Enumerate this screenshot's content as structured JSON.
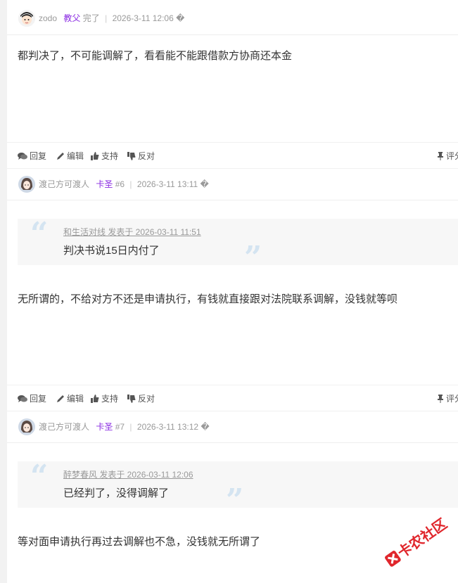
{
  "posts": [
    {
      "author": "zodo",
      "group": "教父",
      "status": "完了",
      "datetime": "2026-3-11 12:06 �",
      "content": "都判决了，不可能调解了，看看能不能跟借款方协商还本金"
    },
    {
      "author": "渡己方可渡人",
      "group": "卡圣",
      "floor": "#6",
      "datetime": "2026-3-11 13:11 �",
      "quote_author": "和生活对线 发表于 2026-03-11 11:51",
      "quote_text": "判决书说15日内付了",
      "content": "无所谓的，不给对方不还是申请执行，有钱就直接跟对法院联系调解，没钱就等呗"
    },
    {
      "author": "渡己方可渡人",
      "group": "卡圣",
      "floor": "#7",
      "datetime": "2026-3-11 13:12 �",
      "quote_author": "醉梦春风 发表于 2026-03-11 12:06",
      "quote_text": "已经判了，没得调解了",
      "content": "等对面申请执行再过去调解也不急，没钱就无所谓了"
    }
  ],
  "actions": {
    "reply": "回复",
    "edit": "编辑",
    "support": "支持",
    "oppose": "反对",
    "rate": "评分"
  },
  "watermark": "卡农社区",
  "colors": {
    "group": "#8a2be2",
    "quote_mark": "#d4e4f1",
    "watermark": "#e0262c"
  }
}
